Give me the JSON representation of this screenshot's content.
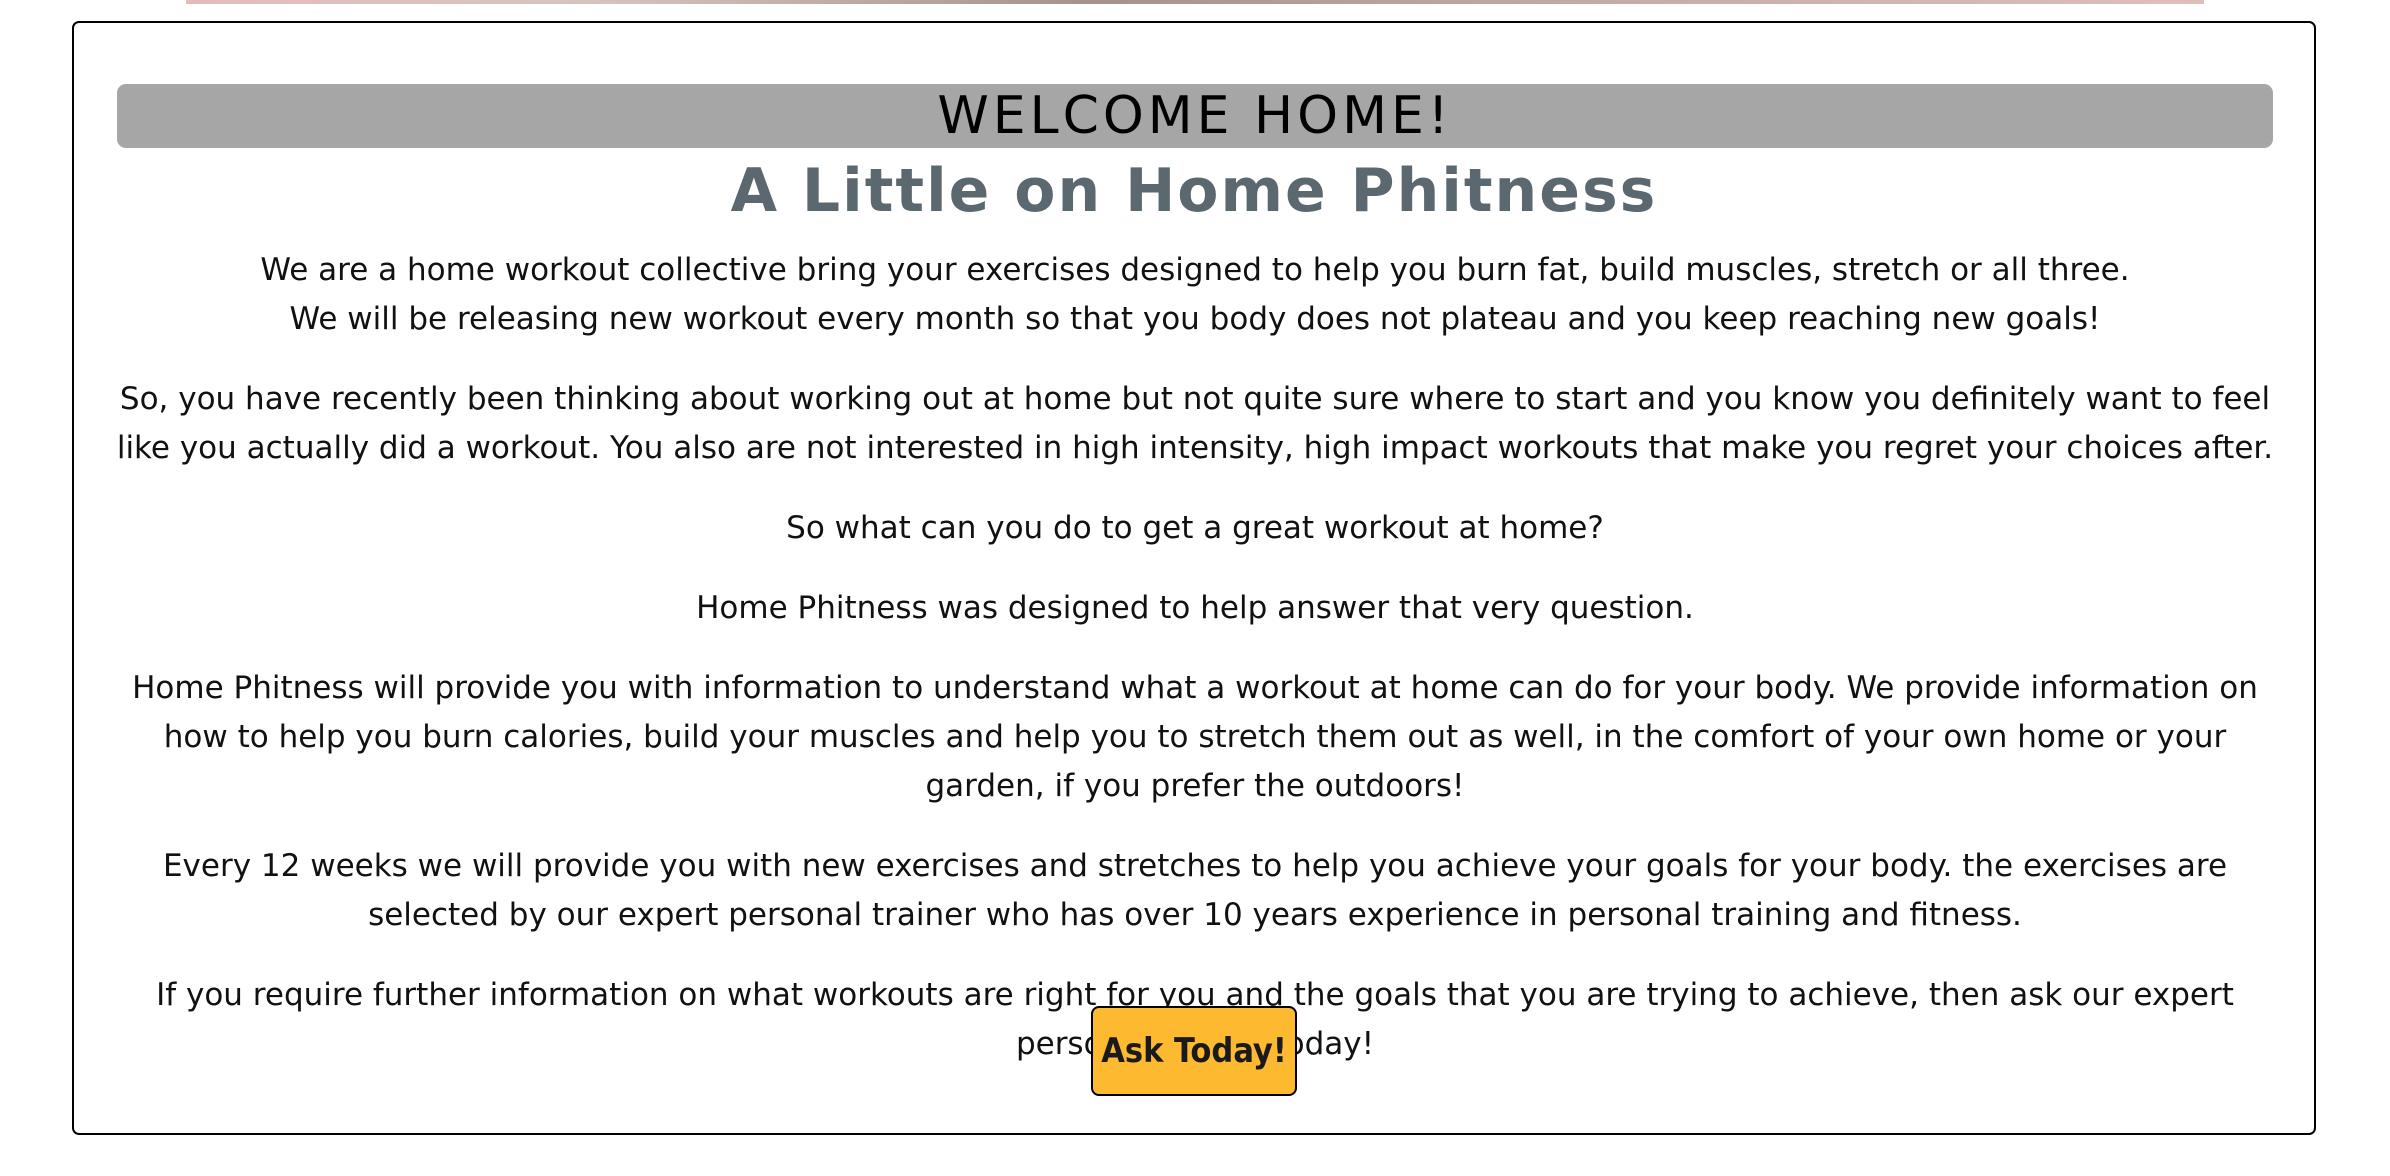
{
  "welcome": {
    "title": "WELCOME HOME!"
  },
  "intro": {
    "subtitle": "A Little on Home Phitness"
  },
  "paragraphs": [
    "We are a home workout collective bring your exercises designed to help you burn fat, build muscles, stretch or all three.",
    "We will be releasing new workout every month so that you body does not plateau and you keep reaching new goals!",
    "So, you have recently been thinking about working out at home but not quite sure where to start and you know you definitely want to feel like you actually did a workout. You also are not interested in high intensity, high impact workouts that make you regret your choices after.",
    "So what can you do to get a great workout at home?",
    "Home Phitness was designed to help answer that very question.",
    "Home Phitness will provide you with information to understand what a workout at home can do for your body. We provide information on how to help you burn calories, build your muscles and help you to stretch them out as well, in the comfort of your own home or your garden, if you prefer the outdoors!",
    "Every 12 weeks we will provide you with new exercises and stretches to help you achieve your goals for your body. the exercises are selected by our expert personal trainer who has over 10 years experience in personal training and fitness.",
    "If you require further information on what workouts are right for you and the goals that you are trying to achieve, then ask our expert personal trainer today!"
  ],
  "cta": {
    "label": "Ask Today!",
    "color": "#fdb92f"
  },
  "colors": {
    "welcome_bar": "#a6a6a6",
    "subtitle": "#5b6870"
  }
}
